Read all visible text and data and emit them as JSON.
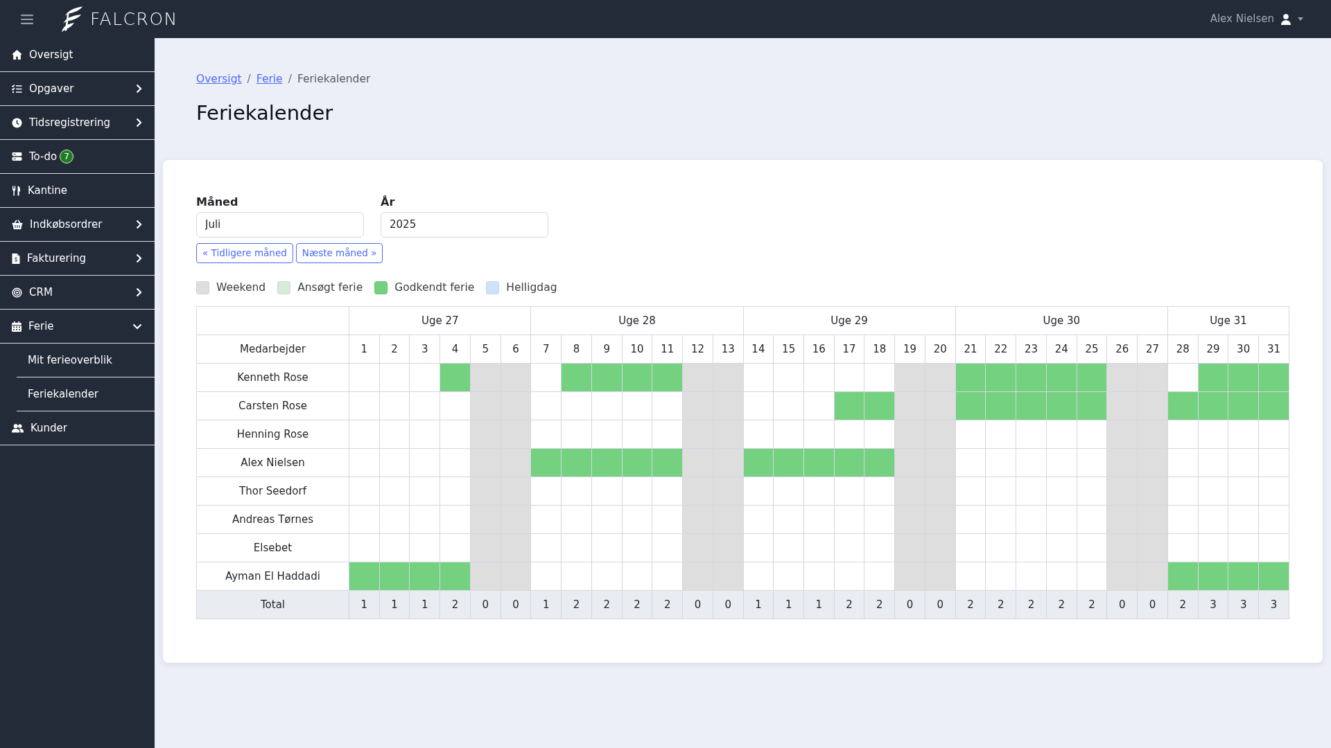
{
  "topbar": {
    "brand": "FALCRON",
    "user": "Alex Nielsen"
  },
  "sidebar": {
    "items": [
      {
        "label": "Oversigt",
        "kind": "link"
      },
      {
        "label": "Opgaver",
        "kind": "group",
        "expanded": false
      },
      {
        "label": "Tidsregistrering",
        "kind": "group",
        "expanded": false
      },
      {
        "label": "To-do",
        "kind": "link",
        "badge": "7"
      },
      {
        "label": "Kantine",
        "kind": "link"
      },
      {
        "label": "Indkøbsordrer",
        "kind": "group",
        "expanded": false
      },
      {
        "label": "Fakturering",
        "kind": "group",
        "expanded": false
      },
      {
        "label": "CRM",
        "kind": "group",
        "expanded": false
      },
      {
        "label": "Ferie",
        "kind": "group",
        "expanded": true,
        "children": [
          {
            "label": "Mit ferieoverblik"
          },
          {
            "label": "Feriekalender"
          }
        ]
      },
      {
        "label": "Kunder",
        "kind": "link"
      }
    ]
  },
  "breadcrumb": [
    {
      "kind": "link",
      "label": "Oversigt"
    },
    {
      "kind": "separator",
      "label": "/"
    },
    {
      "kind": "link",
      "label": "Ferie"
    },
    {
      "kind": "separator",
      "label": "/"
    },
    {
      "kind": "current",
      "label": "Feriekalender"
    }
  ],
  "page_title": "Feriekalender",
  "filters": [
    {
      "label": "Måned",
      "value": "Juli"
    },
    {
      "label": "År",
      "value": "2025"
    }
  ],
  "nav_buttons": [
    "« Tidligere måned",
    "Næste måned »"
  ],
  "legend": [
    {
      "label": "Weekend",
      "kind": "weekend",
      "color": "#dedede"
    },
    {
      "label": "Ansøgt ferie",
      "kind": "requested",
      "color": "#d4ecd9"
    },
    {
      "label": "Godkendt ferie",
      "kind": "approved",
      "color": "#73d17f"
    },
    {
      "label": "Helligdag",
      "kind": "holiday",
      "color": "#cfe2fc"
    }
  ],
  "calendar": {
    "employee_header": "Medarbejder",
    "weeks": [
      {
        "label": "Uge 27",
        "days": [
          {
            "label": "1",
            "weekend": false
          },
          {
            "label": "2",
            "weekend": false
          },
          {
            "label": "3",
            "weekend": false
          },
          {
            "label": "4",
            "weekend": false
          },
          {
            "label": "5",
            "weekend": true
          },
          {
            "label": "6",
            "weekend": true
          }
        ]
      },
      {
        "label": "Uge 28",
        "days": [
          {
            "label": "7",
            "weekend": false
          },
          {
            "label": "8",
            "weekend": false
          },
          {
            "label": "9",
            "weekend": false
          },
          {
            "label": "10",
            "weekend": false
          },
          {
            "label": "11",
            "weekend": false
          },
          {
            "label": "12",
            "weekend": true
          },
          {
            "label": "13",
            "weekend": true
          }
        ]
      },
      {
        "label": "Uge 29",
        "days": [
          {
            "label": "14",
            "weekend": false
          },
          {
            "label": "15",
            "weekend": false
          },
          {
            "label": "16",
            "weekend": false
          },
          {
            "label": "17",
            "weekend": false
          },
          {
            "label": "18",
            "weekend": false
          },
          {
            "label": "19",
            "weekend": true
          },
          {
            "label": "20",
            "weekend": true
          }
        ]
      },
      {
        "label": "Uge 30",
        "days": [
          {
            "label": "21",
            "weekend": false
          },
          {
            "label": "22",
            "weekend": false
          },
          {
            "label": "23",
            "weekend": false
          },
          {
            "label": "24",
            "weekend": false
          },
          {
            "label": "25",
            "weekend": false
          },
          {
            "label": "26",
            "weekend": true
          },
          {
            "label": "27",
            "weekend": true
          }
        ]
      },
      {
        "label": "Uge 31",
        "days": [
          {
            "label": "28",
            "weekend": false
          },
          {
            "label": "29",
            "weekend": false
          },
          {
            "label": "30",
            "weekend": false
          },
          {
            "label": "31",
            "weekend": false
          }
        ]
      }
    ],
    "rows": [
      {
        "name": "Kenneth Rose",
        "cells": [
          {
            "approved": false
          },
          {
            "approved": false
          },
          {
            "approved": false
          },
          {
            "approved": true
          },
          {
            "approved": false
          },
          {
            "approved": false
          },
          {
            "approved": false
          },
          {
            "approved": true
          },
          {
            "approved": true
          },
          {
            "approved": true
          },
          {
            "approved": true
          },
          {
            "approved": false
          },
          {
            "approved": false
          },
          {
            "approved": false
          },
          {
            "approved": false
          },
          {
            "approved": false
          },
          {
            "approved": false
          },
          {
            "approved": false
          },
          {
            "approved": false
          },
          {
            "approved": false
          },
          {
            "approved": true
          },
          {
            "approved": true
          },
          {
            "approved": true
          },
          {
            "approved": true
          },
          {
            "approved": true
          },
          {
            "approved": false
          },
          {
            "approved": false
          },
          {
            "approved": false
          },
          {
            "approved": true
          },
          {
            "approved": true
          },
          {
            "approved": true
          }
        ]
      },
      {
        "name": "Carsten Rose",
        "cells": [
          {
            "approved": false
          },
          {
            "approved": false
          },
          {
            "approved": false
          },
          {
            "approved": false
          },
          {
            "approved": false
          },
          {
            "approved": false
          },
          {
            "approved": false
          },
          {
            "approved": false
          },
          {
            "approved": false
          },
          {
            "approved": false
          },
          {
            "approved": false
          },
          {
            "approved": false
          },
          {
            "approved": false
          },
          {
            "approved": false
          },
          {
            "approved": false
          },
          {
            "approved": false
          },
          {
            "approved": true
          },
          {
            "approved": true
          },
          {
            "approved": false
          },
          {
            "approved": false
          },
          {
            "approved": true
          },
          {
            "approved": true
          },
          {
            "approved": true
          },
          {
            "approved": true
          },
          {
            "approved": true
          },
          {
            "approved": false
          },
          {
            "approved": false
          },
          {
            "approved": true
          },
          {
            "approved": true
          },
          {
            "approved": true
          },
          {
            "approved": true
          }
        ]
      },
      {
        "name": "Henning Rose",
        "cells": [
          {
            "approved": false
          },
          {
            "approved": false
          },
          {
            "approved": false
          },
          {
            "approved": false
          },
          {
            "approved": false
          },
          {
            "approved": false
          },
          {
            "approved": false
          },
          {
            "approved": false
          },
          {
            "approved": false
          },
          {
            "approved": false
          },
          {
            "approved": false
          },
          {
            "approved": false
          },
          {
            "approved": false
          },
          {
            "approved": false
          },
          {
            "approved": false
          },
          {
            "approved": false
          },
          {
            "approved": false
          },
          {
            "approved": false
          },
          {
            "approved": false
          },
          {
            "approved": false
          },
          {
            "approved": false
          },
          {
            "approved": false
          },
          {
            "approved": false
          },
          {
            "approved": false
          },
          {
            "approved": false
          },
          {
            "approved": false
          },
          {
            "approved": false
          },
          {
            "approved": false
          },
          {
            "approved": false
          },
          {
            "approved": false
          },
          {
            "approved": false
          }
        ]
      },
      {
        "name": "Alex Nielsen",
        "cells": [
          {
            "approved": false
          },
          {
            "approved": false
          },
          {
            "approved": false
          },
          {
            "approved": false
          },
          {
            "approved": false
          },
          {
            "approved": false
          },
          {
            "approved": true
          },
          {
            "approved": true
          },
          {
            "approved": true
          },
          {
            "approved": true
          },
          {
            "approved": true
          },
          {
            "approved": false
          },
          {
            "approved": false
          },
          {
            "approved": true
          },
          {
            "approved": true
          },
          {
            "approved": true
          },
          {
            "approved": true
          },
          {
            "approved": true
          },
          {
            "approved": false
          },
          {
            "approved": false
          },
          {
            "approved": false
          },
          {
            "approved": false
          },
          {
            "approved": false
          },
          {
            "approved": false
          },
          {
            "approved": false
          },
          {
            "approved": false
          },
          {
            "approved": false
          },
          {
            "approved": false
          },
          {
            "approved": false
          },
          {
            "approved": false
          },
          {
            "approved": false
          }
        ]
      },
      {
        "name": "Thor Seedorf",
        "cells": [
          {
            "approved": false
          },
          {
            "approved": false
          },
          {
            "approved": false
          },
          {
            "approved": false
          },
          {
            "approved": false
          },
          {
            "approved": false
          },
          {
            "approved": false
          },
          {
            "approved": false
          },
          {
            "approved": false
          },
          {
            "approved": false
          },
          {
            "approved": false
          },
          {
            "approved": false
          },
          {
            "approved": false
          },
          {
            "approved": false
          },
          {
            "approved": false
          },
          {
            "approved": false
          },
          {
            "approved": false
          },
          {
            "approved": false
          },
          {
            "approved": false
          },
          {
            "approved": false
          },
          {
            "approved": false
          },
          {
            "approved": false
          },
          {
            "approved": false
          },
          {
            "approved": false
          },
          {
            "approved": false
          },
          {
            "approved": false
          },
          {
            "approved": false
          },
          {
            "approved": false
          },
          {
            "approved": false
          },
          {
            "approved": false
          },
          {
            "approved": false
          }
        ]
      },
      {
        "name": "Andreas Tørnes",
        "cells": [
          {
            "approved": false
          },
          {
            "approved": false
          },
          {
            "approved": false
          },
          {
            "approved": false
          },
          {
            "approved": false
          },
          {
            "approved": false
          },
          {
            "approved": false
          },
          {
            "approved": false
          },
          {
            "approved": false
          },
          {
            "approved": false
          },
          {
            "approved": false
          },
          {
            "approved": false
          },
          {
            "approved": false
          },
          {
            "approved": false
          },
          {
            "approved": false
          },
          {
            "approved": false
          },
          {
            "approved": false
          },
          {
            "approved": false
          },
          {
            "approved": false
          },
          {
            "approved": false
          },
          {
            "approved": false
          },
          {
            "approved": false
          },
          {
            "approved": false
          },
          {
            "approved": false
          },
          {
            "approved": false
          },
          {
            "approved": false
          },
          {
            "approved": false
          },
          {
            "approved": false
          },
          {
            "approved": false
          },
          {
            "approved": false
          },
          {
            "approved": false
          }
        ]
      },
      {
        "name": "Elsebet",
        "cells": [
          {
            "approved": false
          },
          {
            "approved": false
          },
          {
            "approved": false
          },
          {
            "approved": false
          },
          {
            "approved": false
          },
          {
            "approved": false
          },
          {
            "approved": false
          },
          {
            "approved": false
          },
          {
            "approved": false
          },
          {
            "approved": false
          },
          {
            "approved": false
          },
          {
            "approved": false
          },
          {
            "approved": false
          },
          {
            "approved": false
          },
          {
            "approved": false
          },
          {
            "approved": false
          },
          {
            "approved": false
          },
          {
            "approved": false
          },
          {
            "approved": false
          },
          {
            "approved": false
          },
          {
            "approved": false
          },
          {
            "approved": false
          },
          {
            "approved": false
          },
          {
            "approved": false
          },
          {
            "approved": false
          },
          {
            "approved": false
          },
          {
            "approved": false
          },
          {
            "approved": false
          },
          {
            "approved": false
          },
          {
            "approved": false
          },
          {
            "approved": false
          }
        ]
      },
      {
        "name": "Ayman El Haddadi",
        "cells": [
          {
            "approved": true
          },
          {
            "approved": true
          },
          {
            "approved": true
          },
          {
            "approved": true
          },
          {
            "approved": false
          },
          {
            "approved": false
          },
          {
            "approved": false
          },
          {
            "approved": false
          },
          {
            "approved": false
          },
          {
            "approved": false
          },
          {
            "approved": false
          },
          {
            "approved": false
          },
          {
            "approved": false
          },
          {
            "approved": false
          },
          {
            "approved": false
          },
          {
            "approved": false
          },
          {
            "approved": false
          },
          {
            "approved": false
          },
          {
            "approved": false
          },
          {
            "approved": false
          },
          {
            "approved": false
          },
          {
            "approved": false
          },
          {
            "approved": false
          },
          {
            "approved": false
          },
          {
            "approved": false
          },
          {
            "approved": false
          },
          {
            "approved": false
          },
          {
            "approved": true
          },
          {
            "approved": true
          },
          {
            "approved": true
          },
          {
            "approved": true
          }
        ]
      }
    ],
    "total": {
      "label": "Total",
      "values": [
        "1",
        "1",
        "1",
        "2",
        "0",
        "0",
        "1",
        "2",
        "2",
        "2",
        "2",
        "0",
        "0",
        "1",
        "1",
        "1",
        "2",
        "2",
        "0",
        "0",
        "2",
        "2",
        "2",
        "2",
        "2",
        "0",
        "0",
        "2",
        "3",
        "3",
        "3"
      ]
    }
  }
}
